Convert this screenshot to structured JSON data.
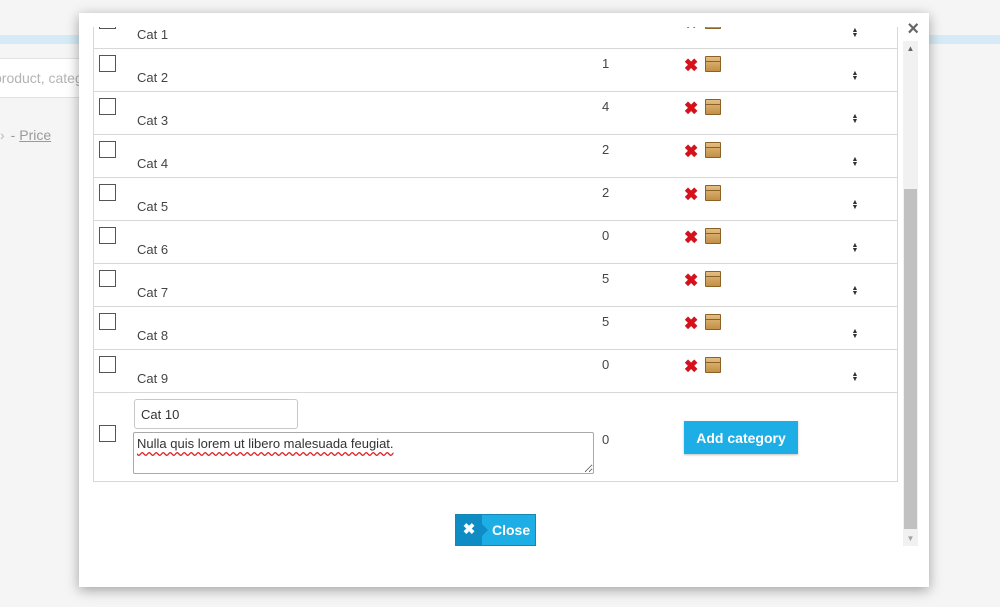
{
  "background": {
    "search_placeholder": "product, category, ...",
    "breadcrumb_separator": "-",
    "price_link": "Price"
  },
  "modal": {
    "close_glyph": "×",
    "rows": [
      {
        "name": "Cat 1",
        "count": ""
      },
      {
        "name": "Cat 2",
        "count": "1"
      },
      {
        "name": "Cat 3",
        "count": "4"
      },
      {
        "name": "Cat 4",
        "count": "2"
      },
      {
        "name": "Cat 5",
        "count": "2"
      },
      {
        "name": "Cat 6",
        "count": "0"
      },
      {
        "name": "Cat 7",
        "count": "5"
      },
      {
        "name": "Cat 8",
        "count": "5"
      },
      {
        "name": "Cat 9",
        "count": "0"
      }
    ],
    "new_row": {
      "name_value": "Cat 10",
      "description_value": "Nulla quis lorem ut libero malesuada feugiat.",
      "count": "0",
      "add_label": "Add category"
    },
    "close_button": {
      "label": "Close",
      "icon": "✖"
    },
    "icons": {
      "delete": "✖",
      "sort": "▲▼",
      "scroll_up": "▲",
      "scroll_down": "▼"
    },
    "colors": {
      "accent": "#1eaee6",
      "delete": "#d6111b"
    }
  }
}
